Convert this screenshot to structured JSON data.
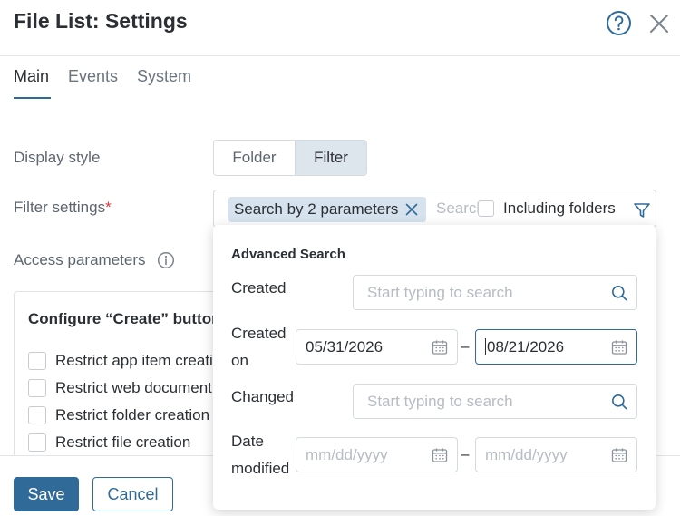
{
  "window": {
    "title": "File List: Settings"
  },
  "tabs": [
    {
      "label": "Main",
      "active": true
    },
    {
      "label": "Events",
      "active": false
    },
    {
      "label": "System",
      "active": false
    }
  ],
  "form": {
    "display_style": {
      "label": "Display style",
      "options": [
        "Folder",
        "Filter"
      ],
      "selected": "Filter"
    },
    "filter_settings": {
      "label": "Filter settings",
      "required_mark": "*",
      "chip": "Search by 2 parameters",
      "search_placeholder": "Search",
      "including_folders": "Including folders"
    },
    "access_parameters": {
      "label": "Access parameters"
    }
  },
  "create_panel": {
    "title": "Configure “Create” button",
    "options": [
      "Restrict app item creation",
      "Restrict web document creation",
      "Restrict folder creation",
      "Restrict file creation"
    ]
  },
  "advanced_search": {
    "title": "Advanced Search",
    "created": {
      "label": "Created",
      "placeholder": "Start typing to search"
    },
    "created_on": {
      "label_line1": "Created",
      "label_line2": "on",
      "from": "05/31/2026",
      "to": "08/21/2026",
      "separator": "–"
    },
    "changed": {
      "label": "Changed",
      "placeholder": "Start typing to search"
    },
    "date_modified": {
      "label_line1": "Date",
      "label_line2": "modified",
      "from_placeholder": "mm/dd/yyyy",
      "to_placeholder": "mm/dd/yyyy",
      "separator": "–"
    }
  },
  "footer": {
    "save": "Save",
    "cancel": "Cancel"
  },
  "colors": {
    "accent": "#2f6a99",
    "chip_bg": "#d6e2ee",
    "required": "#d9383b"
  },
  "icons": [
    "help-icon",
    "close-icon",
    "info-icon",
    "clear-chip-icon",
    "filter-funnel-icon",
    "search-icon",
    "calendar-icon"
  ]
}
